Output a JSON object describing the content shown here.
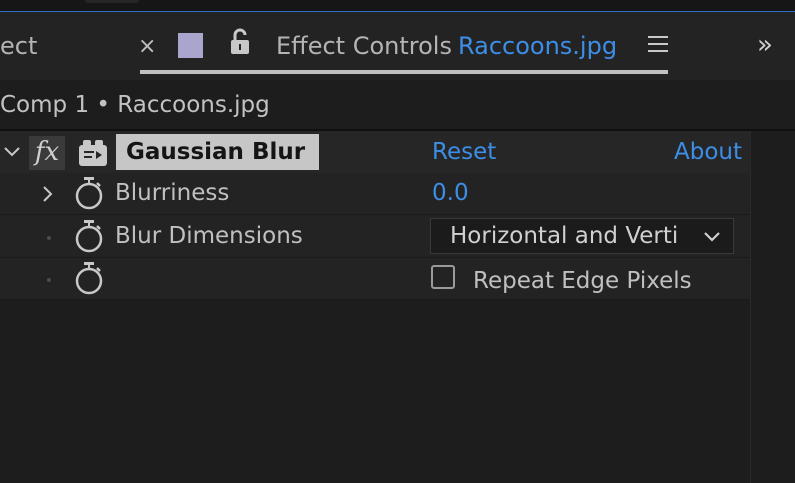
{
  "panel": {
    "partial_tab_label": "ect",
    "close_glyph": "×",
    "tab_title": "Effect Controls",
    "tab_target": "Raccoons.jpg",
    "overflow_glyph": "»",
    "swatch_color": "#a9a5cc",
    "accent_color": "#3d8ee6"
  },
  "breadcrumb": "Comp 1 • Raccoons.jpg",
  "effect": {
    "fx_glyph": "fx",
    "name": "Gaussian Blur",
    "reset_label": "Reset",
    "about_label": "About"
  },
  "properties": {
    "blurriness": {
      "label": "Blurriness",
      "value": "0.0"
    },
    "blur_dimensions": {
      "label": "Blur Dimensions",
      "selected": "Horizontal and Verti"
    },
    "repeat_edge_pixels": {
      "label": "Repeat Edge Pixels",
      "checked": false
    }
  },
  "icons": {
    "close": "close-icon",
    "lock": "lock-icon",
    "menu": "hamburger-menu-icon",
    "overflow": "double-chevron-right-icon",
    "twirl_open": "chevron-down-icon",
    "twirl_closed": "chevron-right-icon",
    "stopwatch": "stopwatch-icon",
    "preset": "effect-preset-icon",
    "dropdown": "chevron-down-icon"
  }
}
